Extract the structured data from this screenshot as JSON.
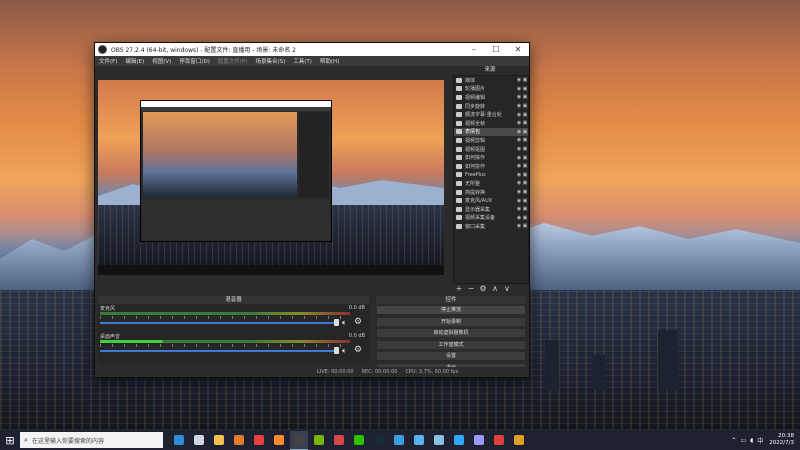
{
  "window": {
    "title": "OBS 27.2.4 (64-bit, windows) - 配置文件: 直播用 - 场景: 未命名 2",
    "minimize": "–",
    "maximize": "☐",
    "close": "✕"
  },
  "menu": [
    {
      "label": "文件(F)",
      "enabled": true
    },
    {
      "label": "编辑(E)",
      "enabled": true
    },
    {
      "label": "视图(V)",
      "enabled": true
    },
    {
      "label": "停靠窗口(D)",
      "enabled": true
    },
    {
      "label": "配置文件(P)",
      "enabled": false
    },
    {
      "label": "场景集合(S)",
      "enabled": true
    },
    {
      "label": "工具(T)",
      "enabled": true
    },
    {
      "label": "帮助(H)",
      "enabled": true
    }
  ],
  "sources": {
    "header": "来源",
    "items": [
      {
        "label": "媒体",
        "icon": "image-icon",
        "active": false
      },
      {
        "label": "轮播图片",
        "icon": "play-icon",
        "active": false
      },
      {
        "label": "视频编辑",
        "icon": "play-icon",
        "active": false
      },
      {
        "label": "同步旋转",
        "icon": "play-icon",
        "active": false
      },
      {
        "label": "顺流字幕-重合处",
        "icon": "text-icon",
        "active": false
      },
      {
        "label": "视频全帧",
        "icon": "image-icon",
        "active": false
      },
      {
        "label": "表情包",
        "icon": "folder-icon",
        "active": true
      },
      {
        "label": "视频剪辑",
        "icon": "image-icon",
        "active": false
      },
      {
        "label": "视频抠图",
        "icon": "image-icon",
        "active": false
      },
      {
        "label": "如何操作",
        "icon": "camera-icon",
        "active": false
      },
      {
        "label": "如何协作",
        "icon": "camera-icon",
        "active": false
      },
      {
        "label": "FreePlus",
        "icon": "camera-icon",
        "active": false
      },
      {
        "label": "无所整",
        "icon": "camera-icon",
        "active": false
      },
      {
        "label": "简提转换",
        "icon": "camera-icon",
        "active": false
      },
      {
        "label": "麦克风/AUX",
        "icon": "camera-icon",
        "active": false
      },
      {
        "label": "显示器采集",
        "icon": "monitor-icon",
        "active": false
      },
      {
        "label": "视频采集设备",
        "icon": "camera-icon",
        "active": false
      },
      {
        "label": "窗口采集",
        "icon": "window-icon",
        "active": false
      }
    ],
    "toolbar": [
      "+",
      "−",
      "⚙",
      "∧",
      "∨"
    ]
  },
  "mixer": {
    "header": "混音器",
    "channels": [
      {
        "name": "麦克风",
        "db": "0.0 dB",
        "live": false
      },
      {
        "name": "桌面声音",
        "db": "0.0 dB",
        "live": true
      }
    ]
  },
  "controls": {
    "header": "控件",
    "buttons": [
      {
        "label": "停止推流",
        "primary": true
      },
      {
        "label": "开始录制",
        "primary": false
      },
      {
        "label": "启动虚拟摄像机",
        "primary": false
      },
      {
        "label": "工作室模式",
        "primary": false
      },
      {
        "label": "设置",
        "primary": false
      },
      {
        "label": "退出",
        "primary": false
      }
    ]
  },
  "statusbar": {
    "live": "LIVE: 00:00:00",
    "rec": "REC: 00:00:00",
    "cpu": "CPU: 3.7%, 60.00 fps"
  },
  "taskbar": {
    "search_placeholder": "在这里输入你要搜索的内容",
    "apps": [
      {
        "name": "edge-icon",
        "color": "#2e8bd6",
        "active": false
      },
      {
        "name": "cloud-icon",
        "color": "#cfd6e0",
        "active": false
      },
      {
        "name": "file-explorer-icon",
        "color": "#f2c14e",
        "active": false
      },
      {
        "name": "store-icon",
        "color": "#e37b2b",
        "active": false
      },
      {
        "name": "chrome-icon",
        "color": "#e5443a",
        "active": false
      },
      {
        "name": "firefox-icon",
        "color": "#ff8a2b",
        "active": false
      },
      {
        "name": "obs-icon",
        "color": "#444444",
        "active": true
      },
      {
        "name": "nvidia-icon",
        "color": "#76b900",
        "active": false
      },
      {
        "name": "paint-icon",
        "color": "#d84a4a",
        "active": false
      },
      {
        "name": "wechat-icon",
        "color": "#2dc100",
        "active": false
      },
      {
        "name": "steam-icon",
        "color": "#1b2838",
        "active": false
      },
      {
        "name": "chat-icon",
        "color": "#3aa0e0",
        "active": false
      },
      {
        "name": "gauge-icon",
        "color": "#5ab0f0",
        "active": false
      },
      {
        "name": "clock-icon",
        "color": "#8ac0e0",
        "active": false
      },
      {
        "name": "ps-icon",
        "color": "#31a8ff",
        "active": false
      },
      {
        "name": "ae-icon",
        "color": "#9999ff",
        "active": false
      },
      {
        "name": "red-app-icon",
        "color": "#e04040",
        "active": false
      },
      {
        "name": "yellow-app-icon",
        "color": "#e0a020",
        "active": false
      }
    ],
    "time": "20:38",
    "date": "2022/7/3"
  }
}
